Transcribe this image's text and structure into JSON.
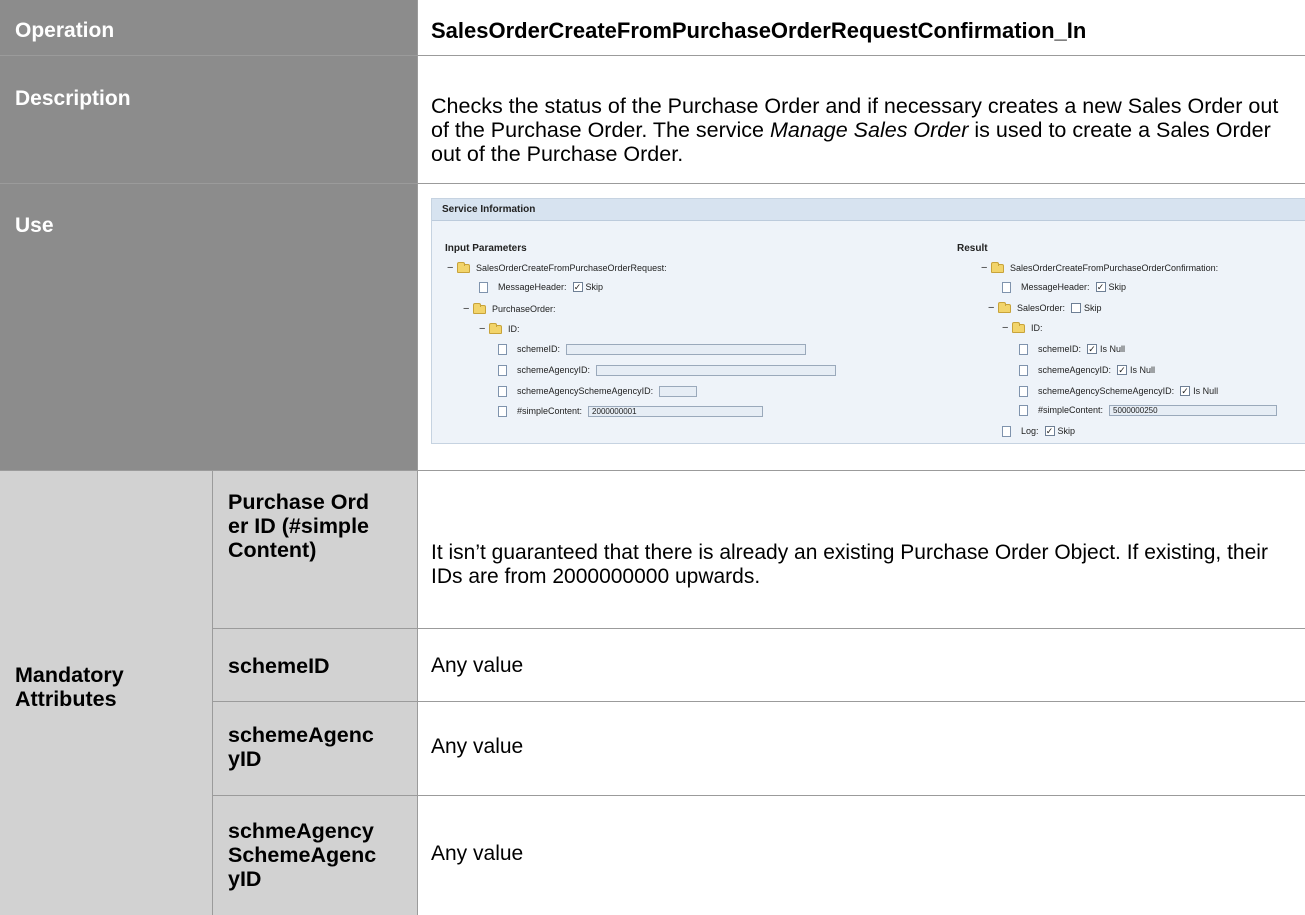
{
  "rows": {
    "operation": {
      "label": "Operation",
      "value": "SalesOrderCreateFromPurchaseOrderRequestConfirmation_In"
    },
    "description": {
      "label": "Description",
      "text_part1": "Checks the status of the Purchase Order and if necessary creates a new Sales Order out of the Purchase Order. The service ",
      "text_italic": "Manage Sales Order",
      "text_part2": " is used to create a Sales Order out of the Purchase Order."
    },
    "use": {
      "label": "Use"
    },
    "mandatory": {
      "label": "Mandatory Attributes",
      "attributes": [
        {
          "name": "Purchase Order ID (#simpleContent)",
          "value": "It isn’t guaranteed that there is already an existing Purchase Order Object. If existing, their IDs are from 2000000000 upwards."
        },
        {
          "name": "schemeID",
          "value": "Any value"
        },
        {
          "name": "schemeAgencyID",
          "value": "Any value"
        },
        {
          "name": "schmeAgencySchemeAgencyID",
          "value": "Any value"
        }
      ]
    }
  },
  "service": {
    "header": "Service Information",
    "input_label": "Input Parameters",
    "result_label": "Result",
    "input": {
      "root": "SalesOrderCreateFromPurchaseOrderRequest:",
      "message_header": "MessageHeader:",
      "skip": "Skip",
      "purchase_order": "PurchaseOrder:",
      "id": "ID:",
      "scheme_id": "schemeID:",
      "scheme_agency_id": "schemeAgencyID:",
      "scheme_agency_scheme_agency_id": "schemeAgencySchemeAgencyID:",
      "simple_content": "#simpleContent:",
      "simple_content_value": "2000000001"
    },
    "result": {
      "root": "SalesOrderCreateFromPurchaseOrderConfirmation:",
      "message_header": "MessageHeader:",
      "skip": "Skip",
      "sales_order": "SalesOrder:",
      "id": "ID:",
      "scheme_id": "schemeID:",
      "scheme_agency_id": "schemeAgencyID:",
      "scheme_agency_scheme_agency_id": "schemeAgencySchemeAgencyID:",
      "is_null": "Is Null",
      "simple_content": "#simpleContent:",
      "simple_content_value": "5000000250",
      "log": "Log:"
    },
    "checkmark": "✓"
  }
}
